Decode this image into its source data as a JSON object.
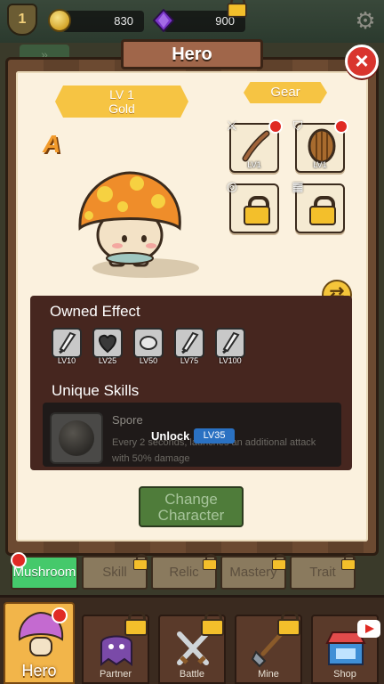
{
  "resources": {
    "player_level": "1",
    "gold": "830",
    "gems": "900"
  },
  "panel": {
    "title": "Hero",
    "close_icon": "×"
  },
  "hero": {
    "level_label": "LV 1",
    "tier_label": "Gold",
    "grade": "A"
  },
  "gear": {
    "title": "Gear",
    "slots": [
      {
        "name": "weapon",
        "level": "LV1",
        "locked": false,
        "icon": "branch-icon"
      },
      {
        "name": "armor",
        "level": "LV1",
        "locked": false,
        "icon": "shield-icon"
      },
      {
        "name": "accessory-1",
        "level": "",
        "locked": true,
        "icon": "lock-icon"
      },
      {
        "name": "accessory-2",
        "level": "",
        "locked": true,
        "icon": "lock-icon"
      }
    ]
  },
  "owned_effect": {
    "title": "Owned Effect",
    "items": [
      {
        "level": "LV10",
        "icon": "sword-icon"
      },
      {
        "level": "LV25",
        "icon": "heart-icon"
      },
      {
        "level": "LV50",
        "icon": "egg-icon"
      },
      {
        "level": "LV75",
        "icon": "sword-icon"
      },
      {
        "level": "LV100",
        "icon": "sword-icon"
      }
    ]
  },
  "unique_skills": {
    "title": "Unique Skills",
    "skill_name": "Spore",
    "description": "Every 2 seconds, launches an additional attack with 50% damage",
    "unlock_label": "Unlock",
    "unlock_level": "LV35"
  },
  "change_button": {
    "line1": "Change",
    "line2": "Character"
  },
  "sub_tabs": [
    {
      "label": "Mushroom",
      "active": true
    },
    {
      "label": "Skill",
      "active": false
    },
    {
      "label": "Relic",
      "active": false
    },
    {
      "label": "Mastery",
      "active": false
    },
    {
      "label": "Trait",
      "active": false
    }
  ],
  "bottom_nav": [
    {
      "label": "Hero",
      "active": true
    },
    {
      "label": "Partner",
      "active": false
    },
    {
      "label": "Battle",
      "active": false
    },
    {
      "label": "Mine",
      "active": false
    },
    {
      "label": "Shop",
      "active": false
    }
  ],
  "colors": {
    "accent_gold": "#f6c443",
    "active_tab": "#45c96b",
    "alert_red": "#e02a24",
    "unlock_blue": "#2a71c2"
  }
}
